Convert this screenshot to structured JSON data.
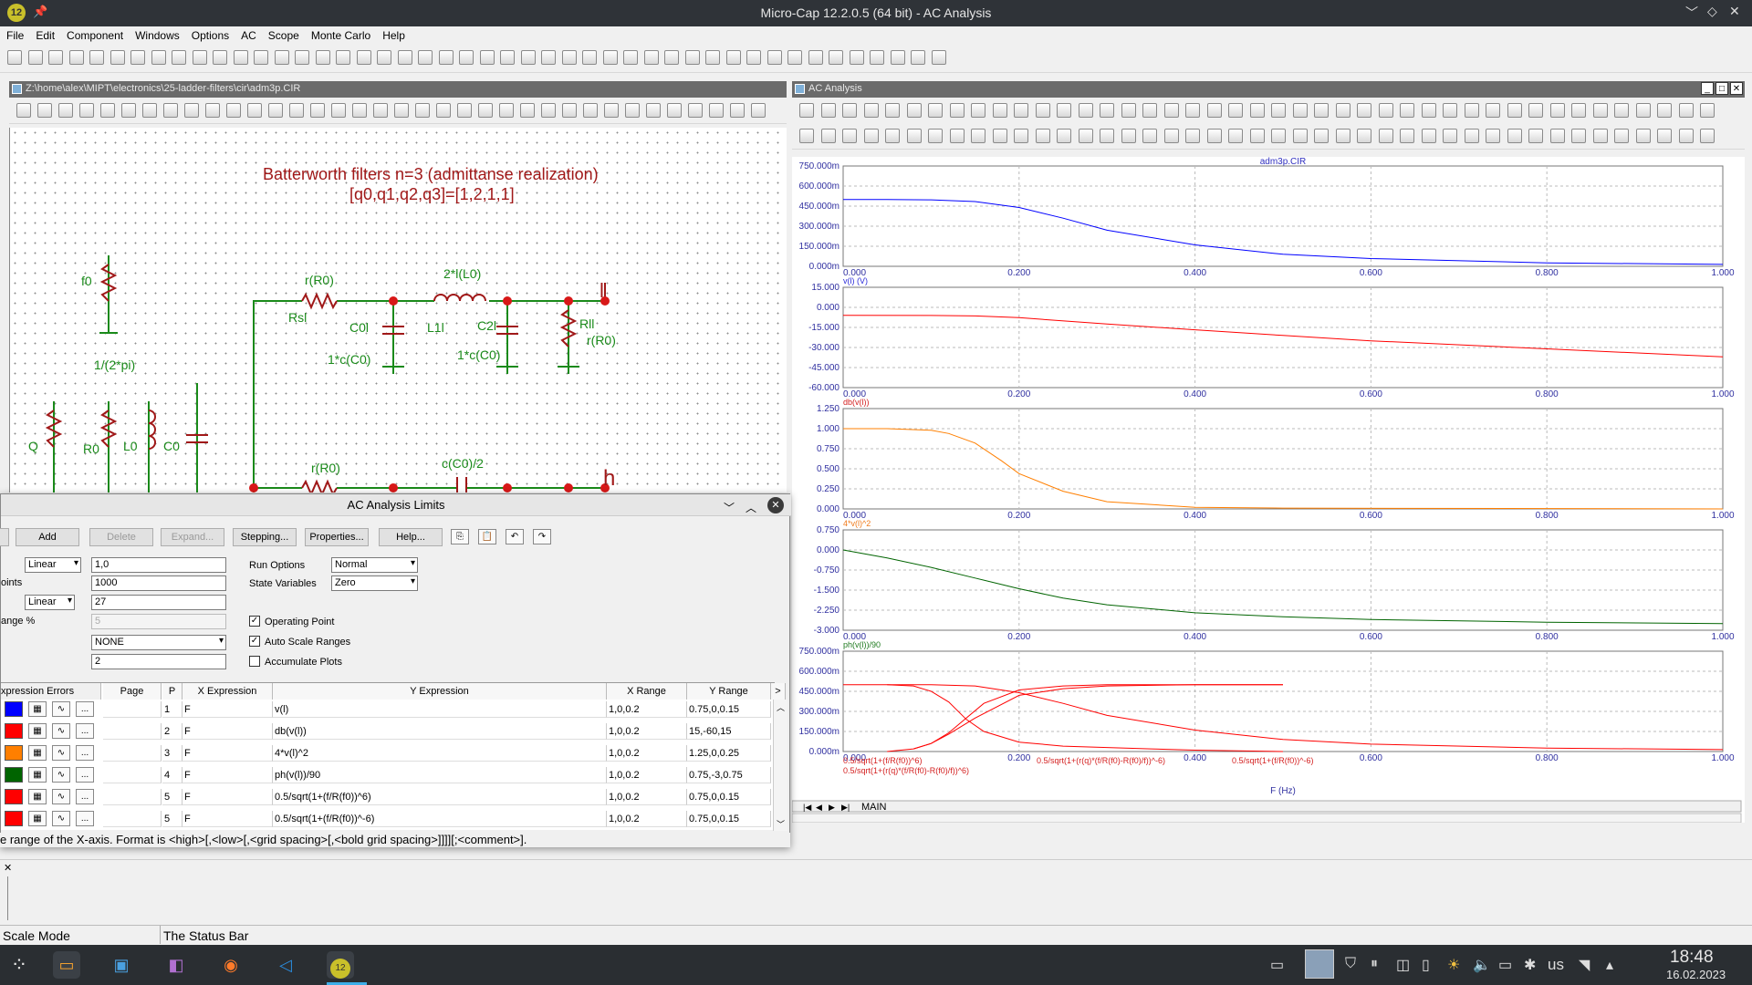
{
  "window": {
    "title": "Micro-Cap 12.2.0.5 (64 bit) - AC Analysis",
    "app_badge": "12"
  },
  "menu": [
    "File",
    "Edit",
    "Component",
    "Windows",
    "Options",
    "AC",
    "Scope",
    "Monte Carlo",
    "Help"
  ],
  "schematic": {
    "title": "Z:\\home\\alex\\MIPT\\electronics\\25-ladder-filters\\cir\\adm3p.CIR",
    "heading1": "Batterworth filters n=3  (admittanse realization)",
    "heading2": "[q0,q1,q2,q3]=[1,2,1,1]",
    "labels": {
      "f0": "f0",
      "f0_val": "1/(2*pi)",
      "rR0_top": "r(R0)",
      "rsl": "Rsl",
      "l_top": "2*l(L0)",
      "l1l": "L1l",
      "c0l": "C0l",
      "c0l_val": "1*c(C0)",
      "c2l": "C2l",
      "c2l_val": "1*c(C0)",
      "rll": "Rll",
      "rll_val": "r(R0)",
      "l_node": "l",
      "q": "Q",
      "r0": "R0",
      "l0": "L0",
      "c0": "C0",
      "rR0_bot": "r(R0)",
      "cC0_2": "c(C0)/2",
      "h_node": "h"
    }
  },
  "analysis": {
    "title": "AC Analysis",
    "file_label": "adm3p.CIR",
    "x_label": "F (Hz)",
    "tab": "MAIN",
    "colors": {
      "blue": "#0000ff",
      "red": "#ff0000",
      "orange": "#ff7f00",
      "green": "#006400"
    },
    "plots": [
      {
        "y_ticks": [
          "750.000m",
          "600.000m",
          "450.000m",
          "300.000m",
          "150.000m",
          "0.000m"
        ],
        "expr_label": "v(l) (V)",
        "color": "#2a2ad8"
      },
      {
        "y_ticks": [
          "15.000",
          "0.000",
          "-15.000",
          "-30.000",
          "-45.000",
          "-60.000"
        ],
        "expr_label": "db(v(l))",
        "color": "#d42020"
      },
      {
        "y_ticks": [
          "1.250",
          "1.000",
          "0.750",
          "0.500",
          "0.250",
          "0.000"
        ],
        "expr_label": "4*v(l)^2",
        "color": "#f07a1a"
      },
      {
        "y_ticks": [
          "0.750",
          "0.000",
          "-0.750",
          "-1.500",
          "-2.250",
          "-3.000"
        ],
        "expr_label": "ph(v(l))/90",
        "color": "#1f7a1f"
      },
      {
        "y_ticks": [
          "750.000m",
          "600.000m",
          "450.000m",
          "300.000m",
          "150.000m",
          "0.000m"
        ],
        "expr_label": "",
        "color": "#d42020"
      }
    ],
    "x_ticks": [
      "0.000",
      "0.200",
      "0.400",
      "0.600",
      "0.800",
      "1.000"
    ],
    "legend5": [
      "0.5/sqrt(1+(f/R(f0))^6)",
      "0.5/sqrt(1+(r(q)*(f/R(f0)-R(f0)/f))^-6)",
      "0.5/sqrt(1+(f/R(f0))^-6)",
      "0.5/sqrt(1+(r(q)*(f/R(f0)-R(f0)/f))^6)"
    ]
  },
  "chart_data": [
    {
      "type": "line",
      "title": "",
      "xlabel": "",
      "ylabel": "v(l) (V)",
      "xlim": [
        0,
        1
      ],
      "ylim": [
        0,
        0.75
      ],
      "series": [
        {
          "name": "v(l)",
          "x": [
            0,
            0.05,
            0.1,
            0.15,
            0.2,
            0.25,
            0.3,
            0.4,
            0.5,
            0.6,
            0.8,
            1.0
          ],
          "y": [
            0.5,
            0.5,
            0.497,
            0.484,
            0.44,
            0.36,
            0.27,
            0.16,
            0.09,
            0.058,
            0.026,
            0.014
          ]
        }
      ]
    },
    {
      "type": "line",
      "title": "",
      "xlabel": "",
      "ylabel": "db(v(l))",
      "xlim": [
        0,
        1
      ],
      "ylim": [
        -60,
        15
      ],
      "series": [
        {
          "name": "db(v(l))",
          "x": [
            0,
            0.1,
            0.15,
            0.2,
            0.3,
            0.4,
            0.5,
            0.6,
            0.8,
            1.0
          ],
          "y": [
            -6,
            -6.1,
            -6.4,
            -7.7,
            -12.5,
            -16.8,
            -21,
            -25,
            -31,
            -37
          ]
        }
      ]
    },
    {
      "type": "line",
      "title": "",
      "xlabel": "",
      "ylabel": "4*v(l)^2",
      "xlim": [
        0,
        1
      ],
      "ylim": [
        0,
        1.25
      ],
      "series": [
        {
          "name": "4*v(l)^2",
          "x": [
            0,
            0.05,
            0.1,
            0.12,
            0.15,
            0.18,
            0.2,
            0.25,
            0.3,
            0.4,
            0.5,
            1.0
          ],
          "y": [
            1,
            1,
            0.98,
            0.94,
            0.82,
            0.6,
            0.44,
            0.22,
            0.09,
            0.02,
            0.01,
            0.0
          ]
        }
      ]
    },
    {
      "type": "line",
      "title": "",
      "xlabel": "",
      "ylabel": "ph(v(l))/90",
      "xlim": [
        0,
        1
      ],
      "ylim": [
        -3,
        0.75
      ],
      "series": [
        {
          "name": "ph(v(l))/90",
          "x": [
            0,
            0.05,
            0.1,
            0.15,
            0.2,
            0.25,
            0.3,
            0.4,
            0.5,
            0.6,
            0.8,
            1.0
          ],
          "y": [
            0,
            -0.3,
            -0.65,
            -1.05,
            -1.45,
            -1.8,
            -2.05,
            -2.35,
            -2.5,
            -2.6,
            -2.7,
            -2.75
          ]
        }
      ]
    },
    {
      "type": "line",
      "title": "",
      "xlabel": "F (Hz)",
      "ylabel": "",
      "xlim": [
        0,
        1
      ],
      "ylim": [
        0,
        0.75
      ],
      "series": [
        {
          "name": "0.5/sqrt(1+(f/R(f0))^6)",
          "x": [
            0,
            0.05,
            0.1,
            0.15,
            0.2,
            0.25,
            0.3,
            0.4,
            0.5,
            0.6,
            0.8,
            1.0
          ],
          "y": [
            0.5,
            0.5,
            0.5,
            0.49,
            0.44,
            0.36,
            0.27,
            0.16,
            0.09,
            0.055,
            0.026,
            0.014
          ]
        },
        {
          "name": "0.5/sqrt(1+(r(q)*(f/R(f0)-R(f0)/f))^-6)",
          "x": [
            0.05,
            0.08,
            0.1,
            0.12,
            0.14,
            0.16,
            0.2,
            0.25,
            0.3,
            0.35,
            0.4,
            0.5
          ],
          "y": [
            0.5,
            0.49,
            0.45,
            0.37,
            0.24,
            0.15,
            0.07,
            0.04,
            0.03,
            0.02,
            0.01,
            0.0
          ]
        },
        {
          "name": "0.5/sqrt(1+(f/R(f0))^-6)",
          "x": [
            0.05,
            0.08,
            0.1,
            0.12,
            0.15,
            0.2,
            0.25,
            0.3,
            0.4,
            0.5
          ],
          "y": [
            0.0,
            0.02,
            0.06,
            0.13,
            0.25,
            0.42,
            0.47,
            0.49,
            0.5,
            0.5
          ]
        },
        {
          "name": "0.5/sqrt(1+(r(q)*(f/R(f0)-R(f0)/f))^6)",
          "x": [
            0.08,
            0.1,
            0.12,
            0.14,
            0.16,
            0.2,
            0.25,
            0.3,
            0.35,
            0.4,
            0.5
          ],
          "y": [
            0.02,
            0.06,
            0.14,
            0.25,
            0.36,
            0.46,
            0.49,
            0.5,
            0.5,
            0.5,
            0.5
          ]
        }
      ]
    }
  ],
  "dialog": {
    "title": "AC Analysis Limits",
    "buttons": [
      "Add",
      "Delete",
      "Expand...",
      "Stepping...",
      "Properties...",
      "Help..."
    ],
    "freq_range_type": "Linear",
    "freq_range": "1,0",
    "points_label": "oints",
    "points": "1000",
    "temp_type": "Linear",
    "temp": "27",
    "range_label": "ange %",
    "range_pct": "5",
    "noise": "NONE",
    "extra": "2",
    "run_options_label": "Run Options",
    "run_options": "Normal",
    "state_vars_label": "State Variables",
    "state_vars": "Zero",
    "op_point_label": "Operating Point",
    "auto_scale_label": "Auto Scale Ranges",
    "accumulate_label": "Accumulate Plots",
    "check_mark": "✓",
    "grid_headers": [
      "xpression Errors",
      "Page",
      "P",
      "X Expression",
      "Y Expression",
      "X Range",
      "Y Range",
      ">"
    ],
    "rows": [
      {
        "p": "1",
        "x": "F",
        "y": "v(l)",
        "xr": "1,0,0.2",
        "yr": "0.75,0,0.15",
        "color": "#0000ff"
      },
      {
        "p": "2",
        "x": "F",
        "y": "db(v(l))",
        "xr": "1,0,0.2",
        "yr": "15,-60,15",
        "color": "#ff0000"
      },
      {
        "p": "3",
        "x": "F",
        "y": "4*v(l)^2",
        "xr": "1,0,0.2",
        "yr": "1.25,0,0.25",
        "color": "#ff7f00"
      },
      {
        "p": "4",
        "x": "F",
        "y": "ph(v(l))/90",
        "xr": "1,0,0.2",
        "yr": "0.75,-3,0.75",
        "color": "#006400"
      },
      {
        "p": "5",
        "x": "F",
        "y": "0.5/sqrt(1+(f/R(f0))^6)",
        "xr": "1,0,0.2",
        "yr": "0.75,0,0.15",
        "color": "#ff0000"
      },
      {
        "p": "5",
        "x": "F",
        "y": "0.5/sqrt(1+(f/R(f0))^-6)",
        "xr": "1,0,0.2",
        "yr": "0.75,0,0.15",
        "color": "#ff0000"
      }
    ],
    "hint": "e range of the X-axis. Format is <high>[,<low>[,<grid spacing>[,<bold grid spacing>]]]][;<comment>]."
  },
  "status": {
    "mode": "Scale Mode",
    "text": "The Status Bar"
  },
  "taskbar": {
    "lang": "us",
    "time": "18:48",
    "date": "16.02.2023"
  }
}
